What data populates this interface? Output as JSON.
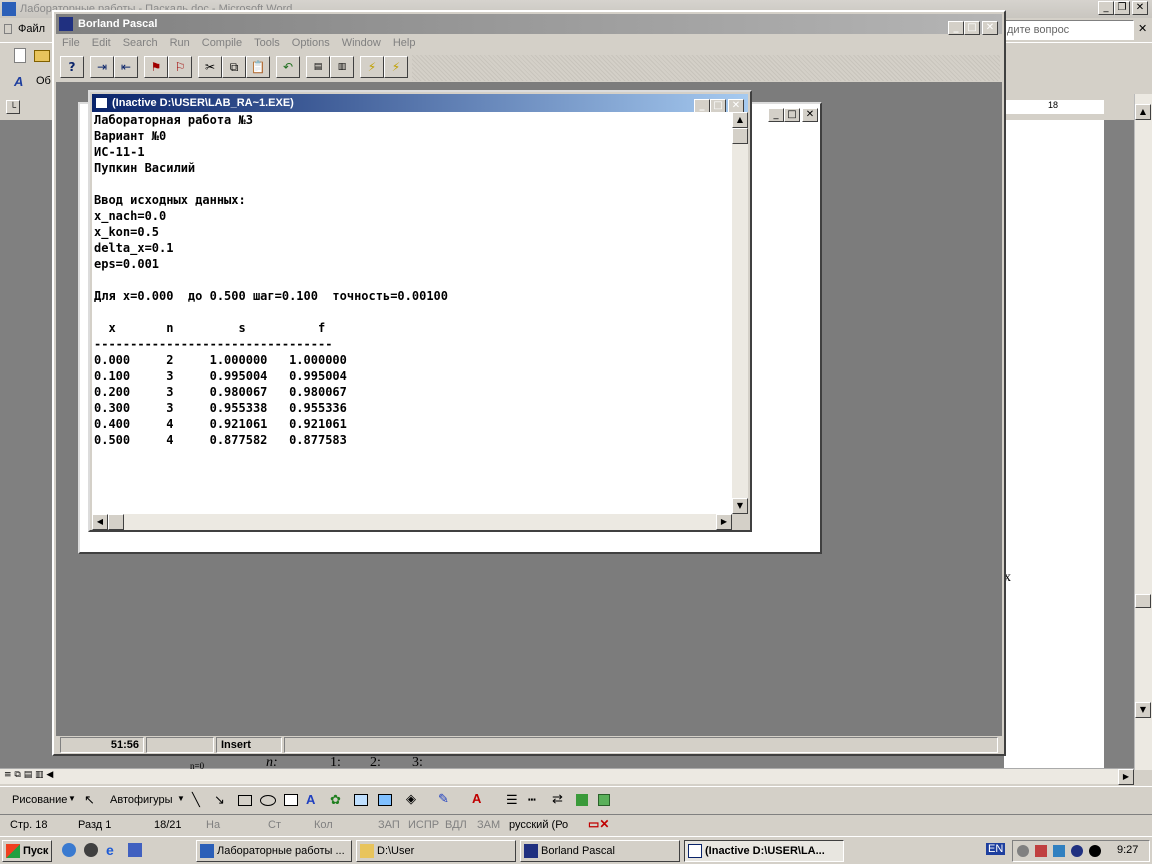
{
  "word": {
    "title": "Лабораторные работы - Паскаль.doc - Microsoft Word",
    "menu_file": "Файл",
    "help_placeholder": "дите вопрос",
    "toolbar_style": "Об",
    "ruler_number": "18",
    "doc_fragment_x": "x",
    "formula_fragments": [
      "n=0",
      "n:",
      "1:",
      "2:",
      "3:"
    ]
  },
  "bp": {
    "title": "Borland Pascal",
    "menu": [
      "File",
      "Edit",
      "Search",
      "Run",
      "Compile",
      "Tools",
      "Options",
      "Window",
      "Help"
    ],
    "status": {
      "position": "51:56",
      "mode": "Insert"
    }
  },
  "dos": {
    "title": "(Inactive D:\\USER\\LAB_RA~1.EXE)",
    "lines": [
      "Лабораторная работа №3",
      "Вариант №0",
      "ИС-11-1",
      "Пупкин Василий",
      "",
      "Ввод исходных данных:",
      "x_nach=0.0",
      "x_kon=0.5",
      "delta_x=0.1",
      "eps=0.001",
      "",
      "Для x=0.000  до 0.500 шаг=0.100  точность=0.00100",
      "",
      "  x       n         s          f",
      "---------------------------------",
      "0.000     2     1.000000   1.000000",
      "0.100     3     0.995004   0.995004",
      "0.200     3     0.980067   0.980067",
      "0.300     3     0.955338   0.955336",
      "0.400     4     0.921061   0.921061",
      "0.500     4     0.877582   0.877583"
    ]
  },
  "drawing": {
    "draw_label": "Рисование",
    "autoshapes_label": "Автофигуры"
  },
  "status": {
    "page": "Стр. 18",
    "section": "Разд 1",
    "pages": "18/21",
    "at": "На",
    "line": "Ст",
    "col": "Кол",
    "rec": "ЗАП",
    "trk": "ИСПР",
    "ext": "ВДЛ",
    "ovr": "ЗАМ",
    "lang": "русский (Ро"
  },
  "taskbar": {
    "start": "Пуск",
    "items": [
      "Лабораторные работы ...",
      "D:\\User",
      "Borland Pascal",
      "(Inactive D:\\USER\\LA..."
    ],
    "lang": "EN",
    "time": "9:27"
  }
}
